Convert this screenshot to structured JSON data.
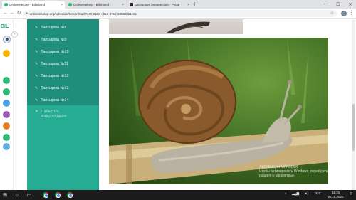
{
  "browser": {
    "tabs": [
      {
        "title": "OnlineMektep - Bilimland",
        "active": true
      },
      {
        "title": "OnlineMektep - Bilimland",
        "active": false
      },
      {
        "title": "Школьные Знания.com - Реши",
        "active": false
      }
    ],
    "new_tab": "+",
    "url": "onlinemektep.org/schedule/lesson/0acf7e09-010d-4bc3-87cd-6308d0b1c6c",
    "window_controls": {
      "minimize": "—",
      "maximize": "☐",
      "close": "✕"
    }
  },
  "app": {
    "logo": "BIL",
    "colors": {
      "sidebar": "#26ac92",
      "sidebar_dark": "#1f8e7a",
      "accent": "#2eb873"
    }
  },
  "sidebar": {
    "items": [
      {
        "label": "Тапсырма №8"
      },
      {
        "label": "Тапсырма №9"
      },
      {
        "label": "Тапсырма №10"
      },
      {
        "label": "Тапсырма №11"
      },
      {
        "label": "Тапсырма №12"
      },
      {
        "label": "Тапсырма №13"
      },
      {
        "label": "Тапсырма №14"
      }
    ],
    "extra": {
      "line1": "Сабақтың",
      "line2": "қорытындысы"
    }
  },
  "main": {
    "image_subject": "snail on a stalk",
    "watermark": {
      "line1": "Активация Windows",
      "line2": "Чтобы активировать Windows, перейдите в",
      "line3": "раздел «Параметры»."
    }
  },
  "taskbar": {
    "clock_time": "14:15",
    "clock_date": "30.10.2020",
    "tray_lang": "РУС"
  }
}
